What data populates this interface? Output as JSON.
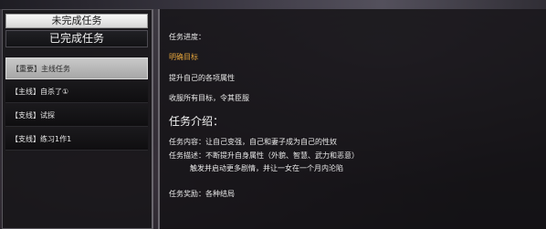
{
  "tabs": {
    "incomplete_label": "未完成任务",
    "completed_label": "已完成任务"
  },
  "task_list": [
    "【重要】主线任务",
    "【主线】自杀了①",
    "【支线】试探",
    "【支线】练习1作1"
  ],
  "detail": {
    "progress_label": "任务进度：",
    "goal_label": "明确目标",
    "line1": "提升自己的各项属性",
    "line2": "收服所有目标，令其臣服",
    "intro_heading": "任务介绍：",
    "content_line": "任务内容：让自己变强，自己和妻子成为自己的性奴",
    "desc_line1": "任务描述：不断提升自身属性（外貌、智慧、武力和恶意）",
    "desc_line2": "触发并启动更多剧情，并让一女在一个月内沦陷",
    "reward_line": "任务奖励：各种结局"
  },
  "colors": {
    "highlight": "#e3a33b",
    "selected_item_bg": "#bdbdbd",
    "tab_active_bg": "#f0f0f0"
  }
}
